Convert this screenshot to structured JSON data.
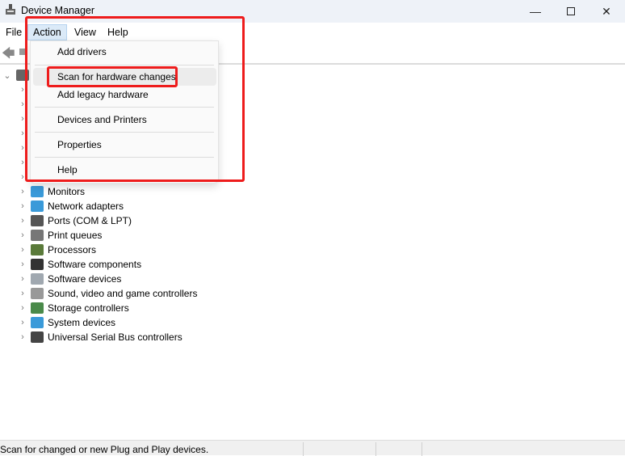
{
  "window": {
    "title": "Device Manager",
    "icon": "device-manager-icon"
  },
  "menubar": [
    "File",
    "Action",
    "View",
    "Help"
  ],
  "action_menu": {
    "items": [
      "Add drivers",
      "Scan for hardware changes",
      "Add legacy hardware",
      "Devices and Printers",
      "Properties",
      "Help"
    ],
    "hovered": "Scan for hardware changes"
  },
  "tree": {
    "visible_items": [
      {
        "label": "Monitors",
        "color": "#3a9ad9"
      },
      {
        "label": "Network adapters",
        "color": "#3a9ad9"
      },
      {
        "label": "Ports (COM & LPT)",
        "color": "#555555"
      },
      {
        "label": "Print queues",
        "color": "#777777"
      },
      {
        "label": "Processors",
        "color": "#5a7a3a"
      },
      {
        "label": "Software components",
        "color": "#333333"
      },
      {
        "label": "Software devices",
        "color": "#a0a8b0"
      },
      {
        "label": "Sound, video and game controllers",
        "color": "#999999"
      },
      {
        "label": "Storage controllers",
        "color": "#4a8a4a"
      },
      {
        "label": "System devices",
        "color": "#3a9ad9"
      },
      {
        "label": "Universal Serial Bus controllers",
        "color": "#444444"
      }
    ]
  },
  "statusbar": {
    "text": "Scan for changed or new Plug and Play devices."
  },
  "colors": {
    "highlight": "#ee1c1c",
    "menu_active": "#dbeaf8"
  }
}
